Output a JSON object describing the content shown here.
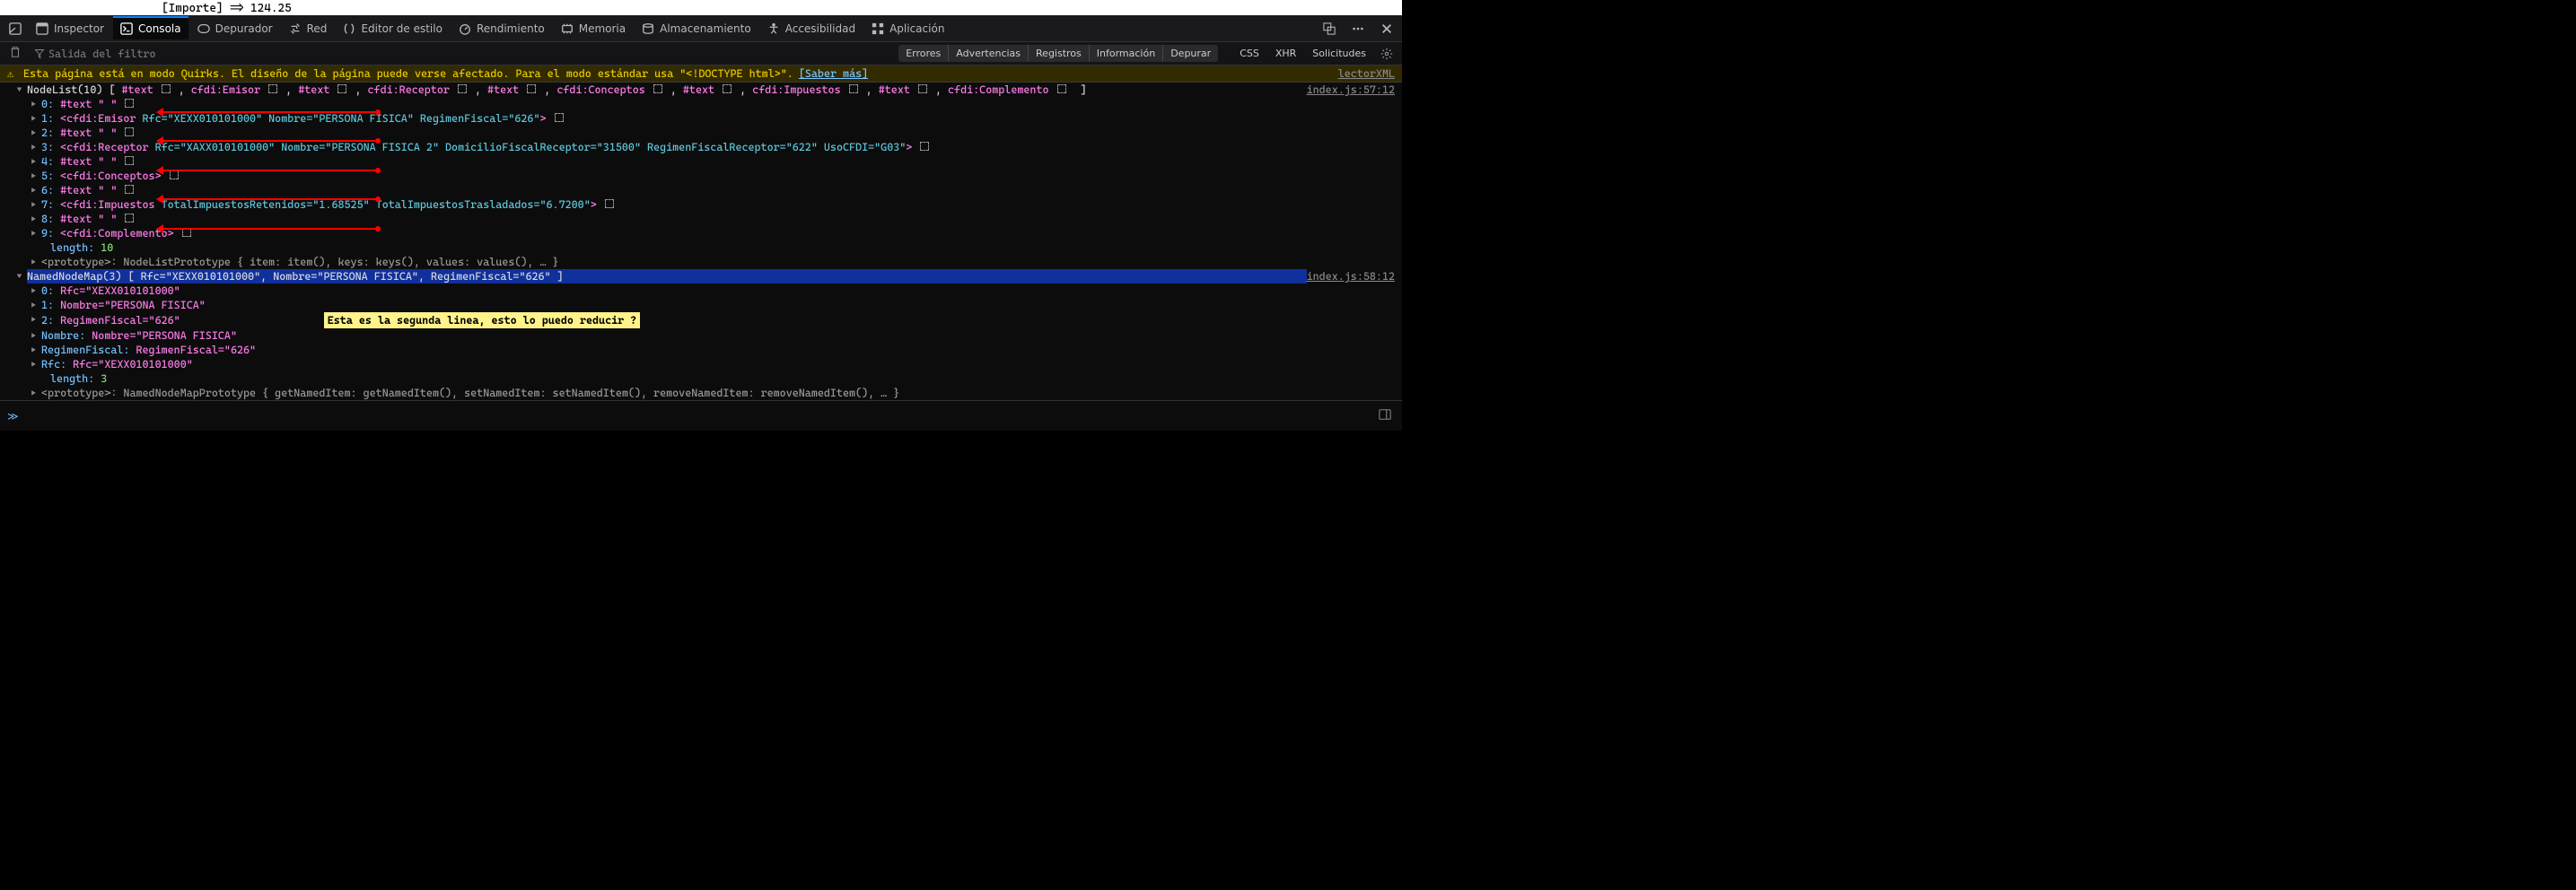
{
  "top_line": "[Importe] => 124.25",
  "toolbar": {
    "inspector": "Inspector",
    "console": "Consola",
    "debugger": "Depurador",
    "network": "Red",
    "style": "Editor de estilo",
    "perf": "Rendimiento",
    "memory": "Memoria",
    "storage": "Almacenamiento",
    "a11y": "Accesibilidad",
    "app": "Aplicación"
  },
  "filter": {
    "placeholder": "Salida del filtro",
    "errors": "Errores",
    "warnings": "Advertencias",
    "logs": "Registros",
    "info": "Información",
    "debug": "Depurar",
    "css": "CSS",
    "xhr": "XHR",
    "requests": "Solicitudes"
  },
  "warn": {
    "msg": "Esta página está en modo Quirks. El diseño de la página puede verse afectado. Para el modo estándar usa \"<!DOCTYPE html>\".",
    "learn": "[Saber más]",
    "src": "lectorXML"
  },
  "nodelist": {
    "label": "NodeList(10)",
    "items_header": [
      "#text",
      "cfdi:Emisor",
      "#text",
      "cfdi:Receptor",
      "#text",
      "cfdi:Conceptos",
      "#text",
      "cfdi:Impuestos",
      "#text",
      "cfdi:Complemento"
    ],
    "src": "index.js:57:12",
    "rows": {
      "r0": {
        "idx": "0:",
        "text": "#text \"  \""
      },
      "r1": {
        "idx": "1:",
        "tag": "cfdi:Emisor",
        "attrs": "Rfc=\"XEXX010101000\" Nombre=\"PERSONA FISICA\" RegimenFiscal=\"626\""
      },
      "r2": {
        "idx": "2:",
        "text": "#text \"  \""
      },
      "r3": {
        "idx": "3:",
        "tag": "cfdi:Receptor",
        "attrs": "Rfc=\"XAXX010101000\" Nombre=\"PERSONA FISICA 2\" DomicilioFiscalReceptor=\"31500\" RegimenFiscalReceptor=\"622\" UsoCFDI=\"G03\""
      },
      "r4": {
        "idx": "4:",
        "text": "#text \"  \""
      },
      "r5": {
        "idx": "5:",
        "tag": "cfdi:Conceptos"
      },
      "r6": {
        "idx": "6:",
        "text": "#text \"  \""
      },
      "r7": {
        "idx": "7:",
        "tag": "cfdi:Impuestos",
        "attrs": "TotalImpuestosRetenidos=\"1.68525\" TotalImpuestosTrasladados=\"6.7200\""
      },
      "r8": {
        "idx": "8:",
        "text": "#text \"  \""
      },
      "r9": {
        "idx": "9:",
        "tag": "cfdi:Complemento"
      }
    },
    "length_label": "length:",
    "length_val": "10",
    "proto": "<prototype>: NodeListPrototype { item: item(), keys: keys(), values: values(), … }"
  },
  "nnm": {
    "header": "NamedNodeMap(3) [ Rfc=\"XEXX010101000\", Nombre=\"PERSONA FISICA\", RegimenFiscal=\"626\" ]",
    "src": "index.js:58:12",
    "r0": {
      "idx": "0:",
      "val": "Rfc=\"XEXX010101000\""
    },
    "r1": {
      "idx": "1:",
      "val": "Nombre=\"PERSONA FISICA\""
    },
    "r2": {
      "idx": "2:",
      "val": "RegimenFiscal=\"626\""
    },
    "nombre": {
      "key": "Nombre:",
      "val": "Nombre=\"PERSONA FISICA\""
    },
    "regimen": {
      "key": "RegimenFiscal:",
      "val": "RegimenFiscal=\"626\""
    },
    "rfc": {
      "key": "Rfc:",
      "val": "Rfc=\"XEXX010101000\""
    },
    "length_label": "length:",
    "length_val": "3",
    "proto": "<prototype>: NamedNodeMapPrototype { getNamedItem: getNamedItem(), setNamedItem: setNamedItem(), removeNamedItem: removeNamedItem(), … }"
  },
  "note": "Esta es la segunda linea, esto lo puedo reducir ?",
  "prompt": "≫"
}
